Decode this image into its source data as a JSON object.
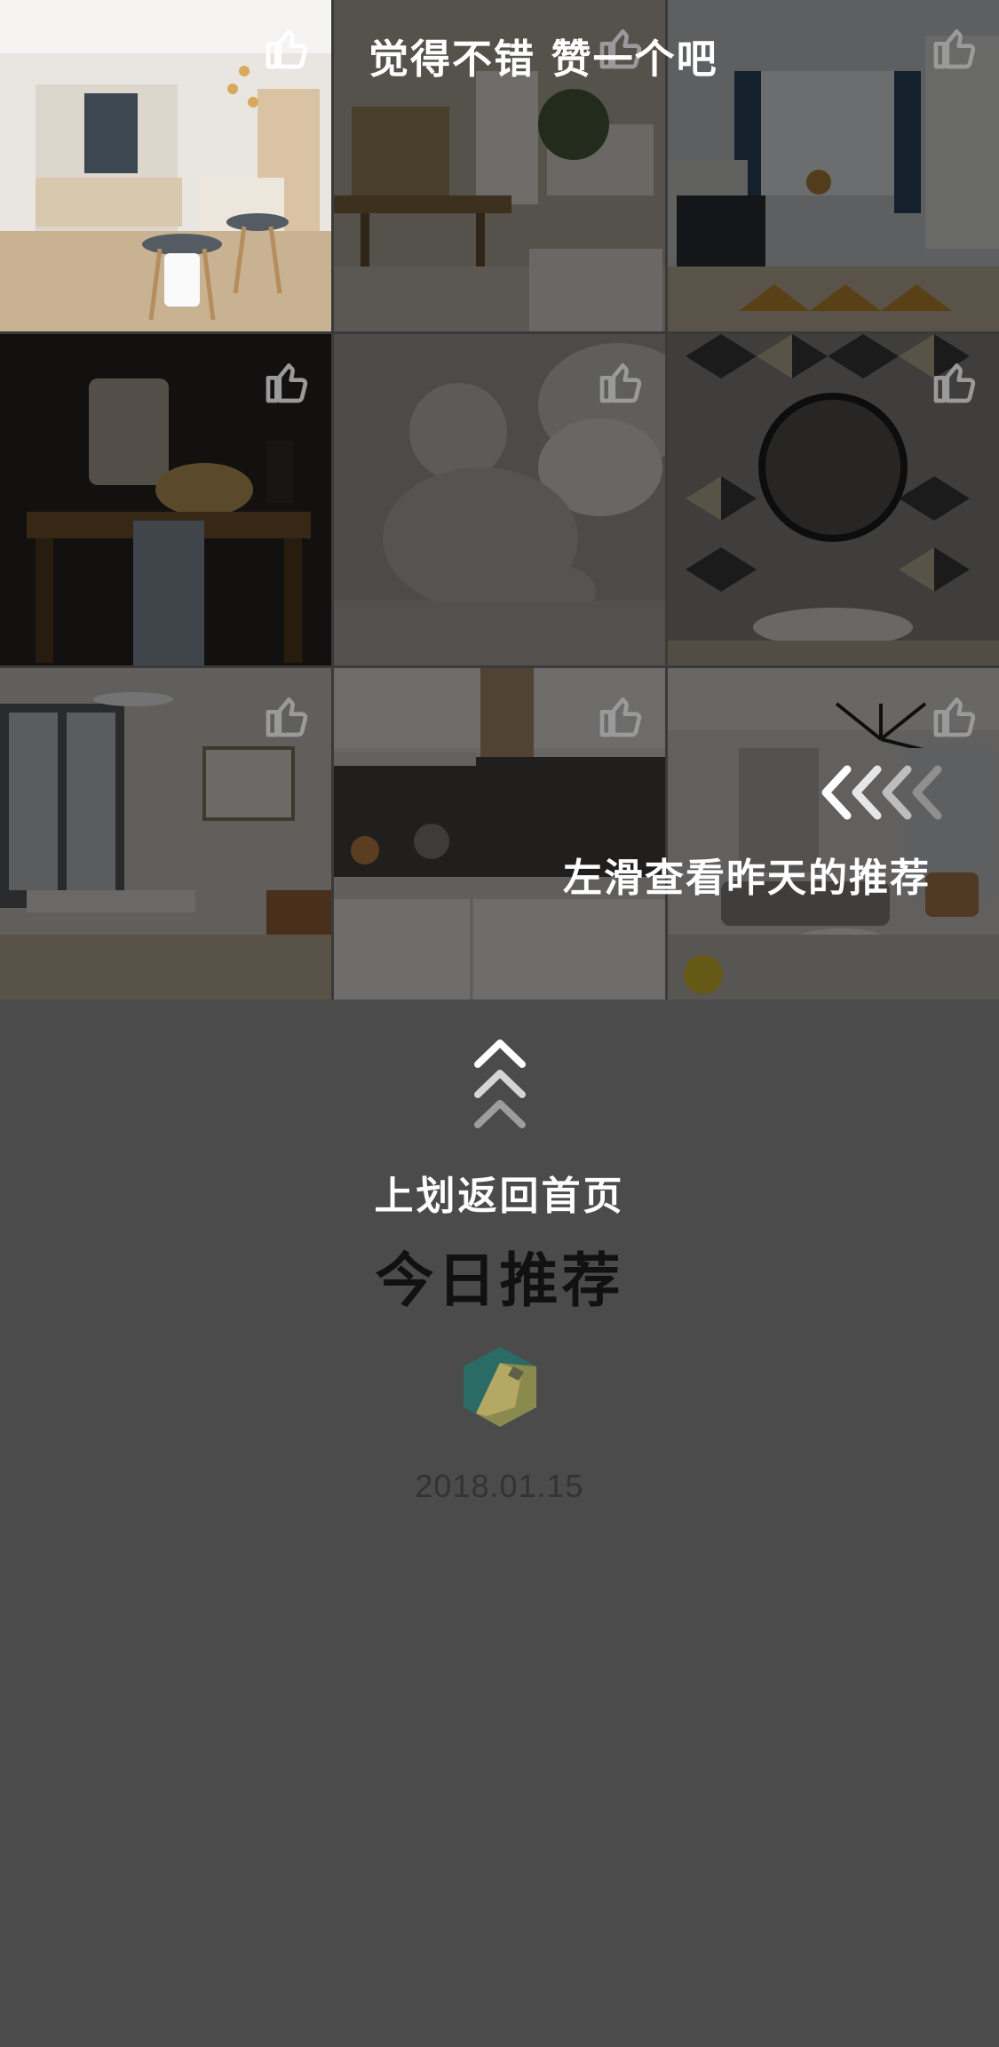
{
  "overlay": {
    "like_hint": "觉得不错 赞一个吧",
    "swipe_hint": "左滑查看昨天的推荐",
    "swipe_icon": "chevrons-left-icon"
  },
  "footer": {
    "up_hint": "上划返回首页",
    "title": "今日推荐",
    "logo_icon": "app-logo-icon",
    "date": "2018.01.15"
  },
  "tiles": [
    {
      "name": "kitchen-island-photo",
      "like_icon": "thumbs-up-icon",
      "active": true
    },
    {
      "name": "dining-room-photo",
      "like_icon": "thumbs-up-icon"
    },
    {
      "name": "living-room-curtains-photo",
      "like_icon": "thumbs-up-icon"
    },
    {
      "name": "bread-still-life-photo",
      "like_icon": "thumbs-up-icon"
    },
    {
      "name": "baby-on-sofa-photo",
      "like_icon": "thumbs-up-icon"
    },
    {
      "name": "bathroom-mirror-photo",
      "like_icon": "thumbs-up-icon"
    },
    {
      "name": "dining-area-photo",
      "like_icon": "thumbs-up-icon"
    },
    {
      "name": "kitchen-counter-photo",
      "like_icon": "thumbs-up-icon"
    },
    {
      "name": "modern-living-room-photo",
      "like_icon": "thumbs-up-icon"
    }
  ],
  "colors": {
    "background": "#4b4b4b",
    "highlight_border": "#ffffff"
  }
}
